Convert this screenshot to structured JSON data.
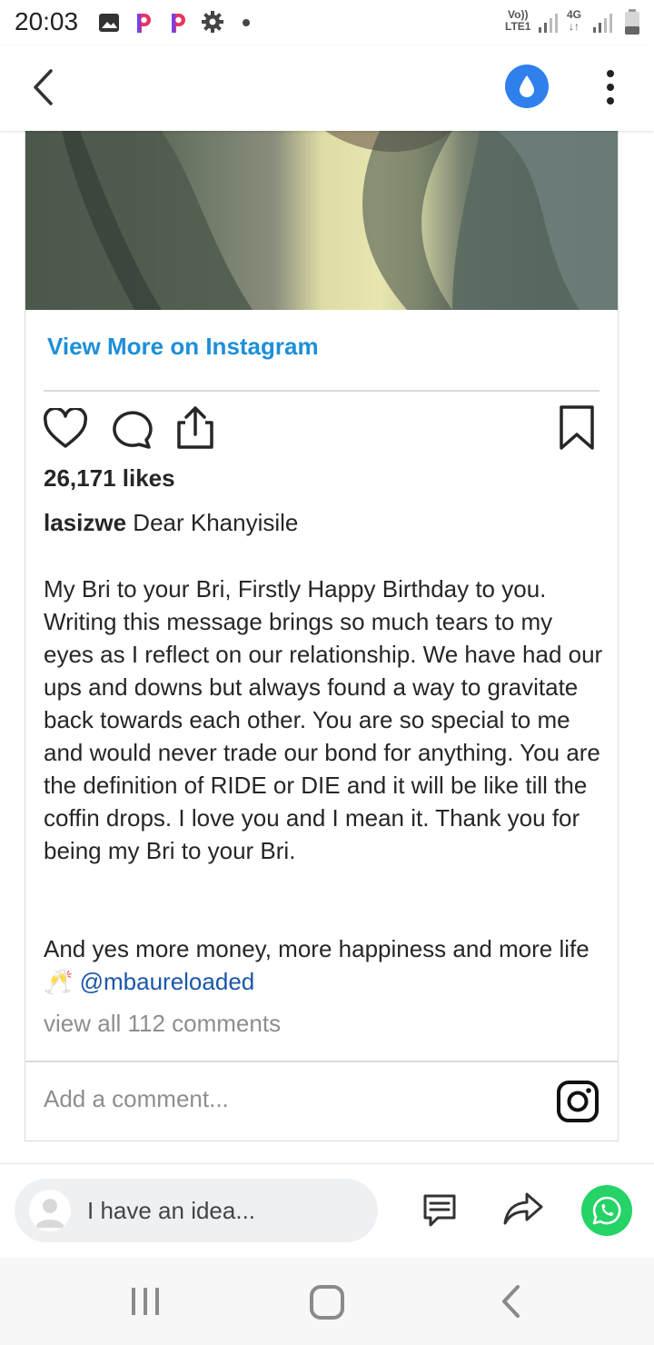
{
  "status_bar": {
    "time": "20:03",
    "network_top": "Vo))",
    "network_bottom": "LTE1",
    "network2_top": "4G",
    "network2_bottom": "↓↑"
  },
  "app_bar": {
    "back_icon": "chevron-left-icon",
    "drop_icon": "water-drop-icon",
    "menu_icon": "more-vert-icon"
  },
  "post": {
    "view_more": "View More on Instagram",
    "likes": "26,171 likes",
    "username": "lasizwe",
    "caption_first": "Dear Khanyisile",
    "body": "My Bri to your Bri, Firstly Happy Birthday to you. Writing this message brings so much tears to my eyes as I reflect on our relationship. We have had our ups and downs but always found a way to gravitate back towards each other. You are so special to me and would never trade our bond for anything. You are the definition of RIDE or DIE and it will be like till the coffin drops. I love you and I mean it. Thank you for being my Bri to your Bri.",
    "closing": "And yes more money, more happiness and more life",
    "closing_emoji": "🥂",
    "mention": "@mbaureloaded",
    "view_all_comments": "view all 112 comments",
    "add_comment_placeholder": "Add a comment..."
  },
  "bottom_bar": {
    "idea_placeholder": "I have an idea..."
  },
  "colors": {
    "link_blue": "#1d8fd9",
    "mention_blue": "#1b56a8",
    "drop_blue": "#2f80ed",
    "whatsapp_green": "#25d366"
  }
}
